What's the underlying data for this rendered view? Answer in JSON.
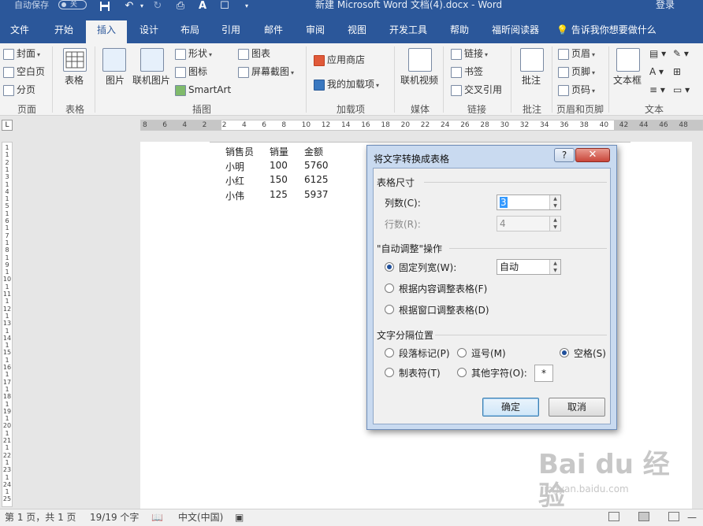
{
  "titlebar": {
    "autosave_label": "自动保存",
    "toggle_state": "关",
    "doc_title": "新建 Microsoft Word 文档(4).docx  -  Word",
    "login": "登录"
  },
  "tabs": [
    "文件",
    "开始",
    "插入",
    "设计",
    "布局",
    "引用",
    "邮件",
    "审阅",
    "视图",
    "开发工具",
    "帮助",
    "福昕阅读器"
  ],
  "active_tab": "插入",
  "tell_me": "告诉我你想要做什么",
  "ribbon": {
    "pages": {
      "items": [
        "封面",
        "空白页",
        "分页"
      ],
      "group": "页面"
    },
    "tables": {
      "item": "表格",
      "group": "表格"
    },
    "illustrations": {
      "picture": "图片",
      "online_picture": "联机图片",
      "shapes": "形状",
      "icons": "图标",
      "smartart": "SmartArt",
      "chart": "图表",
      "screenshot": "屏幕截图",
      "group": "插图"
    },
    "addins": {
      "store": "应用商店",
      "my_addins": "我的加载项",
      "group": "加载项"
    },
    "media": {
      "online_video": "联机视频",
      "group": "媒体"
    },
    "links": {
      "link": "链接",
      "bookmark": "书签",
      "cross_ref": "交叉引用",
      "group": "链接"
    },
    "comments": {
      "comment": "批注",
      "group": "批注"
    },
    "header_footer": {
      "header": "页眉",
      "footer": "页脚",
      "page_number": "页码",
      "group": "页眉和页脚"
    },
    "text": {
      "textbox": "文本框",
      "group": "文本"
    }
  },
  "ruler": {
    "ticks": [
      "8",
      "6",
      "4",
      "2",
      "2",
      "4",
      "6",
      "8",
      "10",
      "12",
      "14",
      "16",
      "18",
      "20",
      "22",
      "24",
      "26",
      "28",
      "30",
      "32",
      "34",
      "36",
      "38",
      "40",
      "42",
      "44",
      "46",
      "48"
    ]
  },
  "vruler": {
    "ticks": [
      "1",
      "1",
      "2",
      "1",
      "3",
      "1",
      "4",
      "1",
      "5",
      "1",
      "6",
      "1",
      "7",
      "1",
      "8",
      "1",
      "9",
      "1",
      "10",
      "1",
      "11",
      "1",
      "12",
      "1",
      "13",
      "1",
      "14",
      "1",
      "15",
      "1",
      "16",
      "1",
      "17",
      "1",
      "18",
      "1",
      "19",
      "1",
      "20",
      "1",
      "21",
      "1",
      "22",
      "1",
      "23",
      "1",
      "24",
      "1",
      "25"
    ]
  },
  "document": {
    "rows": [
      [
        "销售员",
        "销量",
        "金额"
      ],
      [
        "小明",
        "100",
        "5760"
      ],
      [
        "小红",
        "150",
        "6125"
      ],
      [
        "小伟",
        "125",
        "5937"
      ]
    ]
  },
  "dialog": {
    "title": "将文字转换成表格",
    "help": "?",
    "close": "✕",
    "section_size": "表格尺寸",
    "columns_label": "列数(C):",
    "columns_value": "3",
    "rows_label": "行数(R):",
    "rows_value": "4",
    "section_autofit": "\"自动调整\"操作",
    "fixed_width_label": "固定列宽(W):",
    "fixed_width_value": "自动",
    "autofit_content": "根据内容调整表格(F)",
    "autofit_window": "根据窗口调整表格(D)",
    "section_separator": "文字分隔位置",
    "sep_paragraph": "段落标记(P)",
    "sep_comma": "逗号(M)",
    "sep_space": "空格(S)",
    "sep_tab": "制表符(T)",
    "sep_other": "其他字符(O):",
    "sep_other_value": "*",
    "ok": "确定",
    "cancel": "取消"
  },
  "status": {
    "page": "第 1 页，共 1 页",
    "words": "19/19 个字",
    "language": "中文(中国)"
  },
  "watermark": {
    "line1": "Bai du 经验",
    "line2": "jingyan.baidu.com"
  },
  "colors": {
    "brand": "#2b579a",
    "dialog_frame": "#c9daf0",
    "close": "#c9463a"
  }
}
